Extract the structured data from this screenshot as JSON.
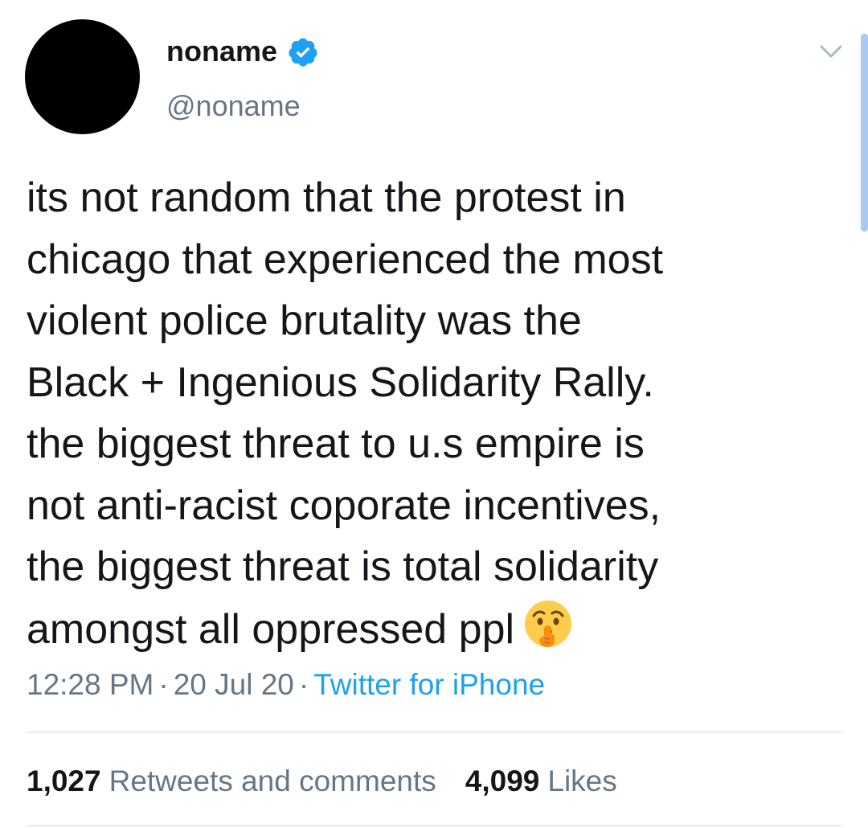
{
  "user": {
    "display_name": "noname",
    "handle": "@noname",
    "verified": true,
    "avatar_color": "#000000"
  },
  "tweet": {
    "lines": [
      "its not random that the protest in",
      "chicago that experienced the most",
      "violent police brutality was the",
      "Black + Ingenious Solidarity Rally.",
      "the biggest threat to u.s empire is",
      "not anti-racist coporate incentives,",
      "the biggest threat is total solidarity",
      "amongst all oppressed ppl"
    ],
    "emoji": "shushing-face-icon"
  },
  "meta": {
    "time": "12:28 PM",
    "separator": "·",
    "date": "20 Jul 20",
    "source": "Twitter for iPhone"
  },
  "stats": {
    "retweets_count": "1,027",
    "retweets_label": "Retweets and comments",
    "likes_count": "4,099",
    "likes_label": "Likes"
  },
  "colors": {
    "primary_text": "#14171a",
    "secondary_text": "#657786",
    "link": "#1da1f2",
    "verified_badge": "#1da1f2",
    "divider": "#e6ecf0",
    "scroll_indicator": "#a9c9f1"
  }
}
